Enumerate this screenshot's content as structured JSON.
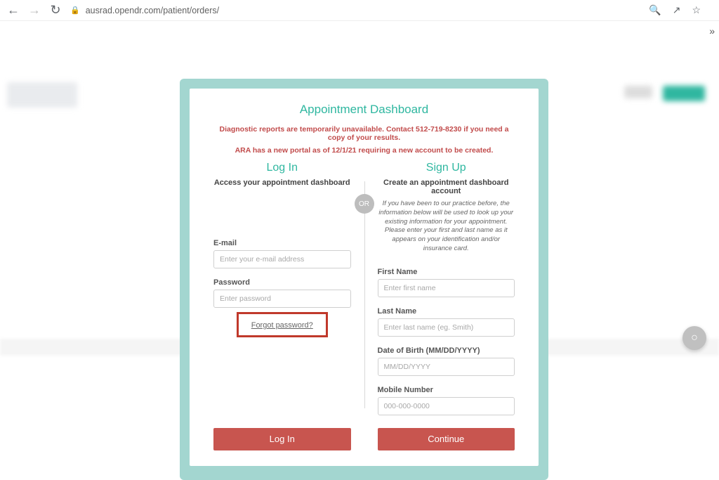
{
  "browser": {
    "url": "ausrad.opendr.com/patient/orders/"
  },
  "page": {
    "title": "Appointment Dashboard",
    "alert1": "Diagnostic reports are temporarily unavailable. Contact 512-719-8230 if you need a copy of your results.",
    "alert2": "ARA has a new portal as of 12/1/21 requiring a new account to be created."
  },
  "or_label": "OR",
  "login": {
    "heading": "Log In",
    "subtitle": "Access your appointment dashboard",
    "email_label": "E-mail",
    "email_placeholder": "Enter your e-mail address",
    "password_label": "Password",
    "password_placeholder": "Enter password",
    "forgot": "Forgot password?",
    "button": "Log In"
  },
  "signup": {
    "heading": "Sign Up",
    "subtitle": "Create an appointment dashboard account",
    "note": "If you have been to our practice before, the information below will be used to look up your existing information for your appointment. Please enter your first and last name as it appears on your identification and/or insurance card.",
    "first_label": "First Name",
    "first_placeholder": "Enter first name",
    "last_label": "Last Name",
    "last_placeholder": "Enter last name (eg. Smith)",
    "dob_label": "Date of Birth (MM/DD/YYYY)",
    "dob_placeholder": "MM/DD/YYYY",
    "mobile_label": "Mobile Number",
    "mobile_placeholder": "000-000-0000",
    "button": "Continue"
  }
}
